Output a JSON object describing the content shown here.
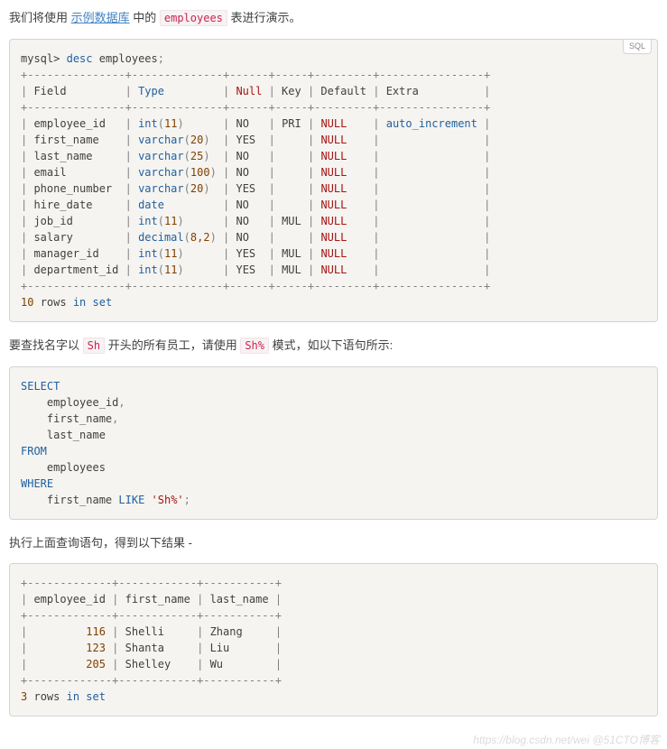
{
  "intro": {
    "t1": "我们将使用 ",
    "link": "示例数据库",
    "t2": " 中的 ",
    "code": "employees",
    "t3": " 表进行演示。"
  },
  "block1": {
    "badge": "SQL",
    "prompt": "mysql>",
    "kw": "desc",
    "tbl": "employees",
    "semicolon": ";",
    "sep_top": "+---------------+--------------+------+-----+---------+----------------+",
    "hd": {
      "field": "Field",
      "type": "Type",
      "null": "Null",
      "key": "Key",
      "default": "Default",
      "extra": "Extra"
    },
    "rows": [
      {
        "f": "employee_id",
        "t1": "int",
        "tp": "11",
        "n": "NO",
        "k": "PRI",
        "d": "NULL",
        "e": "auto_increment"
      },
      {
        "f": "first_name",
        "t1": "varchar",
        "tp": "20",
        "n": "YES",
        "k": "",
        "d": "NULL",
        "e": ""
      },
      {
        "f": "last_name",
        "t1": "varchar",
        "tp": "25",
        "n": "NO",
        "k": "",
        "d": "NULL",
        "e": ""
      },
      {
        "f": "email",
        "t1": "varchar",
        "tp": "100",
        "n": "NO",
        "k": "",
        "d": "NULL",
        "e": ""
      },
      {
        "f": "phone_number",
        "t1": "varchar",
        "tp": "20",
        "n": "YES",
        "k": "",
        "d": "NULL",
        "e": ""
      },
      {
        "f": "hire_date",
        "t1": "date",
        "tp": "",
        "n": "NO",
        "k": "",
        "d": "NULL",
        "e": ""
      },
      {
        "f": "job_id",
        "t1": "int",
        "tp": "11",
        "n": "NO",
        "k": "MUL",
        "d": "NULL",
        "e": ""
      },
      {
        "f": "salary",
        "t1": "decimal",
        "tp": "8,2",
        "n": "NO",
        "k": "",
        "d": "NULL",
        "e": ""
      },
      {
        "f": "manager_id",
        "t1": "int",
        "tp": "11",
        "n": "YES",
        "k": "MUL",
        "d": "NULL",
        "e": ""
      },
      {
        "f": "department_id",
        "t1": "int",
        "tp": "11",
        "n": "YES",
        "k": "MUL",
        "d": "NULL",
        "e": ""
      }
    ],
    "footer": "10 rows in set"
  },
  "para2": {
    "t1": "要查找名字以 ",
    "c1": "Sh",
    "t2": " 开头的所有员工，请使用 ",
    "c2": "Sh%",
    "t3": " 模式，如以下语句所示:"
  },
  "block2": {
    "select": "SELECT",
    "cols": [
      "employee_id",
      "first_name",
      "last_name"
    ],
    "from": "FROM",
    "table": "employees",
    "where": "WHERE",
    "expr_col": "first_name",
    "like": "LIKE",
    "pattern": "'Sh%'",
    "semicolon": ";"
  },
  "para3": "执行上面查询语句，得到以下结果 -",
  "block3": {
    "sep": "+-------------+------------+-----------+",
    "hd": {
      "c1": "employee_id",
      "c2": "first_name",
      "c3": "last_name"
    },
    "rows": [
      {
        "id": "116",
        "fn": "Shelli",
        "ln": "Zhang"
      },
      {
        "id": "123",
        "fn": "Shanta",
        "ln": "Liu"
      },
      {
        "id": "205",
        "fn": "Shelley",
        "ln": "Wu"
      }
    ],
    "footer": "3 rows in set"
  },
  "watermark": "https://blog.csdn.net/wei   @51CTO博客",
  "chart_data": {
    "type": "table",
    "title": "desc employees",
    "columns": [
      "Field",
      "Type",
      "Null",
      "Key",
      "Default",
      "Extra"
    ],
    "rows": [
      [
        "employee_id",
        "int(11)",
        "NO",
        "PRI",
        "NULL",
        "auto_increment"
      ],
      [
        "first_name",
        "varchar(20)",
        "YES",
        "",
        "NULL",
        ""
      ],
      [
        "last_name",
        "varchar(25)",
        "NO",
        "",
        "NULL",
        ""
      ],
      [
        "email",
        "varchar(100)",
        "NO",
        "",
        "NULL",
        ""
      ],
      [
        "phone_number",
        "varchar(20)",
        "YES",
        "",
        "NULL",
        ""
      ],
      [
        "hire_date",
        "date",
        "NO",
        "",
        "NULL",
        ""
      ],
      [
        "job_id",
        "int(11)",
        "NO",
        "MUL",
        "NULL",
        ""
      ],
      [
        "salary",
        "decimal(8,2)",
        "NO",
        "",
        "NULL",
        ""
      ],
      [
        "manager_id",
        "int(11)",
        "YES",
        "MUL",
        "NULL",
        ""
      ],
      [
        "department_id",
        "int(11)",
        "YES",
        "MUL",
        "NULL",
        ""
      ]
    ],
    "result_table": {
      "columns": [
        "employee_id",
        "first_name",
        "last_name"
      ],
      "rows": [
        [
          116,
          "Shelli",
          "Zhang"
        ],
        [
          123,
          "Shanta",
          "Liu"
        ],
        [
          205,
          "Shelley",
          "Wu"
        ]
      ]
    }
  }
}
